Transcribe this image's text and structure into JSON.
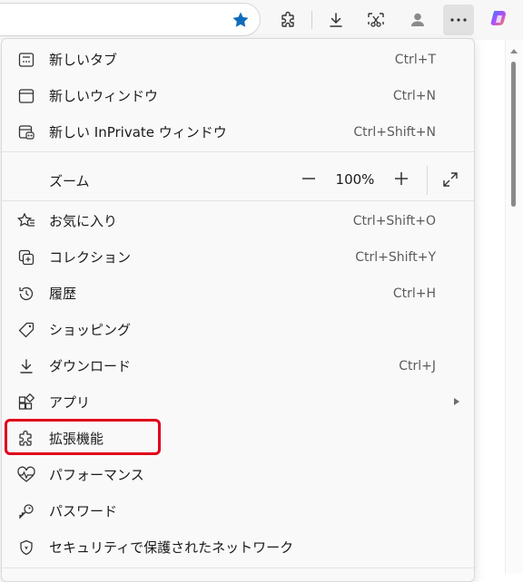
{
  "toolbar": {
    "icons": [
      "favorite-star-icon",
      "extensions-icon",
      "downloads-icon",
      "screenshot-icon",
      "profile-icon",
      "more-icon",
      "copilot-icon"
    ],
    "accent": "#0f6cbd"
  },
  "menu": {
    "items": [
      {
        "label": "新しいタブ",
        "shortcut": "Ctrl+T",
        "icon": "new-tab-icon"
      },
      {
        "label": "新しいウィンドウ",
        "shortcut": "Ctrl+N",
        "icon": "new-window-icon"
      },
      {
        "label": "新しい InPrivate ウィンドウ",
        "shortcut": "Ctrl+Shift+N",
        "icon": "inprivate-icon"
      },
      {
        "label": "お気に入り",
        "shortcut": "Ctrl+Shift+O",
        "icon": "favorites-icon"
      },
      {
        "label": "コレクション",
        "shortcut": "Ctrl+Shift+Y",
        "icon": "collections-icon"
      },
      {
        "label": "履歴",
        "shortcut": "Ctrl+H",
        "icon": "history-icon"
      },
      {
        "label": "ショッピング",
        "shortcut": "",
        "icon": "shopping-tag-icon"
      },
      {
        "label": "ダウンロード",
        "shortcut": "Ctrl+J",
        "icon": "download-icon"
      },
      {
        "label": "アプリ",
        "shortcut": "",
        "icon": "apps-icon"
      },
      {
        "label": "拡張機能",
        "shortcut": "",
        "icon": "extensions-icon"
      },
      {
        "label": "パフォーマンス",
        "shortcut": "",
        "icon": "performance-icon"
      },
      {
        "label": "パスワード",
        "shortcut": "",
        "icon": "key-icon"
      },
      {
        "label": "セキュリティで保護されたネットワーク",
        "shortcut": "",
        "icon": "shield-icon"
      }
    ],
    "zoom": {
      "label": "ズーム",
      "value": "100%",
      "minus": "−",
      "plus": "+"
    }
  },
  "highlight_color": "#e0001b"
}
